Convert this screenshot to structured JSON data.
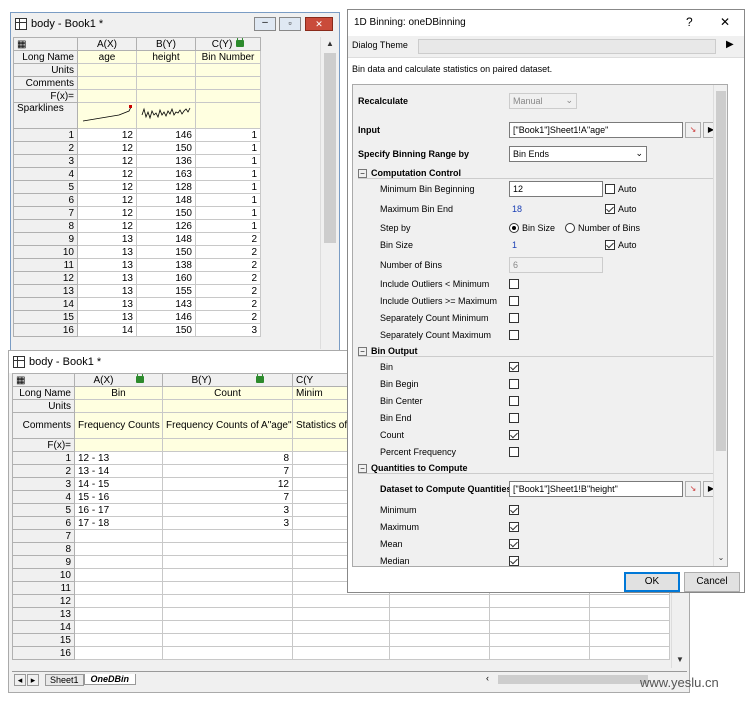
{
  "book1": {
    "title": "body - Book1 *",
    "col_headers": [
      "A(X)",
      "B(Y)",
      "C(Y)"
    ],
    "label_rows": [
      "Long Name",
      "Units",
      "Comments",
      "F(x)=",
      "Sparklines"
    ],
    "long_names": [
      "age",
      "height",
      "Bin Number"
    ],
    "rows": [
      {
        "n": "1",
        "a": "12",
        "b": "146",
        "c": "1"
      },
      {
        "n": "2",
        "a": "12",
        "b": "150",
        "c": "1"
      },
      {
        "n": "3",
        "a": "12",
        "b": "136",
        "c": "1"
      },
      {
        "n": "4",
        "a": "12",
        "b": "163",
        "c": "1"
      },
      {
        "n": "5",
        "a": "12",
        "b": "128",
        "c": "1"
      },
      {
        "n": "6",
        "a": "12",
        "b": "148",
        "c": "1"
      },
      {
        "n": "7",
        "a": "12",
        "b": "150",
        "c": "1"
      },
      {
        "n": "8",
        "a": "12",
        "b": "126",
        "c": "1"
      },
      {
        "n": "9",
        "a": "13",
        "b": "148",
        "c": "2"
      },
      {
        "n": "10",
        "a": "13",
        "b": "150",
        "c": "2"
      },
      {
        "n": "11",
        "a": "13",
        "b": "138",
        "c": "2"
      },
      {
        "n": "12",
        "a": "13",
        "b": "160",
        "c": "2"
      },
      {
        "n": "13",
        "a": "13",
        "b": "155",
        "c": "2"
      },
      {
        "n": "14",
        "a": "13",
        "b": "143",
        "c": "2"
      },
      {
        "n": "15",
        "a": "13",
        "b": "146",
        "c": "2"
      },
      {
        "n": "16",
        "a": "14",
        "b": "150",
        "c": "3"
      }
    ]
  },
  "book2": {
    "title": "body - Book1 *",
    "col_headers": [
      "A(X)",
      "B(Y)",
      "C(Y"
    ],
    "label_rows": [
      "Long Name",
      "Units",
      "Comments",
      "F(x)="
    ],
    "long_names": [
      "Bin",
      "Count",
      "Minim"
    ],
    "comments": [
      "Frequency Counts",
      "Frequency Counts of A\"age\"",
      "Statistics of"
    ],
    "rows": [
      {
        "n": "1",
        "a": "12 - 13",
        "b": "8"
      },
      {
        "n": "2",
        "a": "13 - 14",
        "b": "7"
      },
      {
        "n": "3",
        "a": "14 - 15",
        "b": "12"
      },
      {
        "n": "4",
        "a": "15 - 16",
        "b": "7"
      },
      {
        "n": "5",
        "a": "16 - 17",
        "b": "3"
      },
      {
        "n": "6",
        "a": "17 - 18",
        "b": "3"
      },
      {
        "n": "7",
        "a": "",
        "b": ""
      },
      {
        "n": "8",
        "a": "",
        "b": ""
      },
      {
        "n": "9",
        "a": "",
        "b": ""
      },
      {
        "n": "10",
        "a": "",
        "b": ""
      },
      {
        "n": "11",
        "a": "",
        "b": ""
      },
      {
        "n": "12",
        "a": "",
        "b": ""
      },
      {
        "n": "13",
        "a": "",
        "b": ""
      },
      {
        "n": "14",
        "a": "",
        "b": ""
      },
      {
        "n": "15",
        "a": "",
        "b": ""
      },
      {
        "n": "16",
        "a": "",
        "b": ""
      }
    ],
    "sheet_tabs": [
      "Sheet1",
      "OneDBin"
    ]
  },
  "dialog": {
    "title": "1D Binning: oneDBinning",
    "help": "?",
    "close": "✕",
    "theme_label": "Dialog Theme",
    "description": "Bin data and calculate statistics on paired dataset.",
    "recalculate_label": "Recalculate",
    "recalculate_value": "Manual",
    "input_label": "Input",
    "input_value": "[\"Book1\"]Sheet1!A\"age\"",
    "range_label": "Specify Binning Range by",
    "range_value": "Bin Ends",
    "computation_control": "Computation Control",
    "min_bin_label": "Minimum Bin Beginning",
    "min_bin_value": "12",
    "max_bin_label": "Maximum Bin End",
    "max_bin_value": "18",
    "auto": "Auto",
    "step_label": "Step by",
    "step_bin_size": "Bin Size",
    "step_num_bins": "Number of Bins",
    "bin_size_label": "Bin Size",
    "bin_size_value": "1",
    "num_bins_label": "Number of Bins",
    "num_bins_value": "6",
    "outliers_min": "Include Outliers < Minimum",
    "outliers_max": "Include Outliers >= Maximum",
    "sep_min": "Separately Count Minimum",
    "sep_max": "Separately Count Maximum",
    "bin_output": "Bin Output",
    "out_bin": "Bin",
    "out_begin": "Bin Begin",
    "out_center": "Bin Center",
    "out_end": "Bin End",
    "out_count": "Count",
    "out_pct": "Percent Frequency",
    "quantities": "Quantities to Compute",
    "dataset_label": "Dataset to Compute Quantities",
    "dataset_value": "[\"Book1\"]Sheet1!B\"height\"",
    "q_min": "Minimum",
    "q_max": "Maximum",
    "q_mean": "Mean",
    "q_median": "Median",
    "ok": "OK",
    "cancel": "Cancel"
  },
  "watermark": "www.yeslu.cn"
}
